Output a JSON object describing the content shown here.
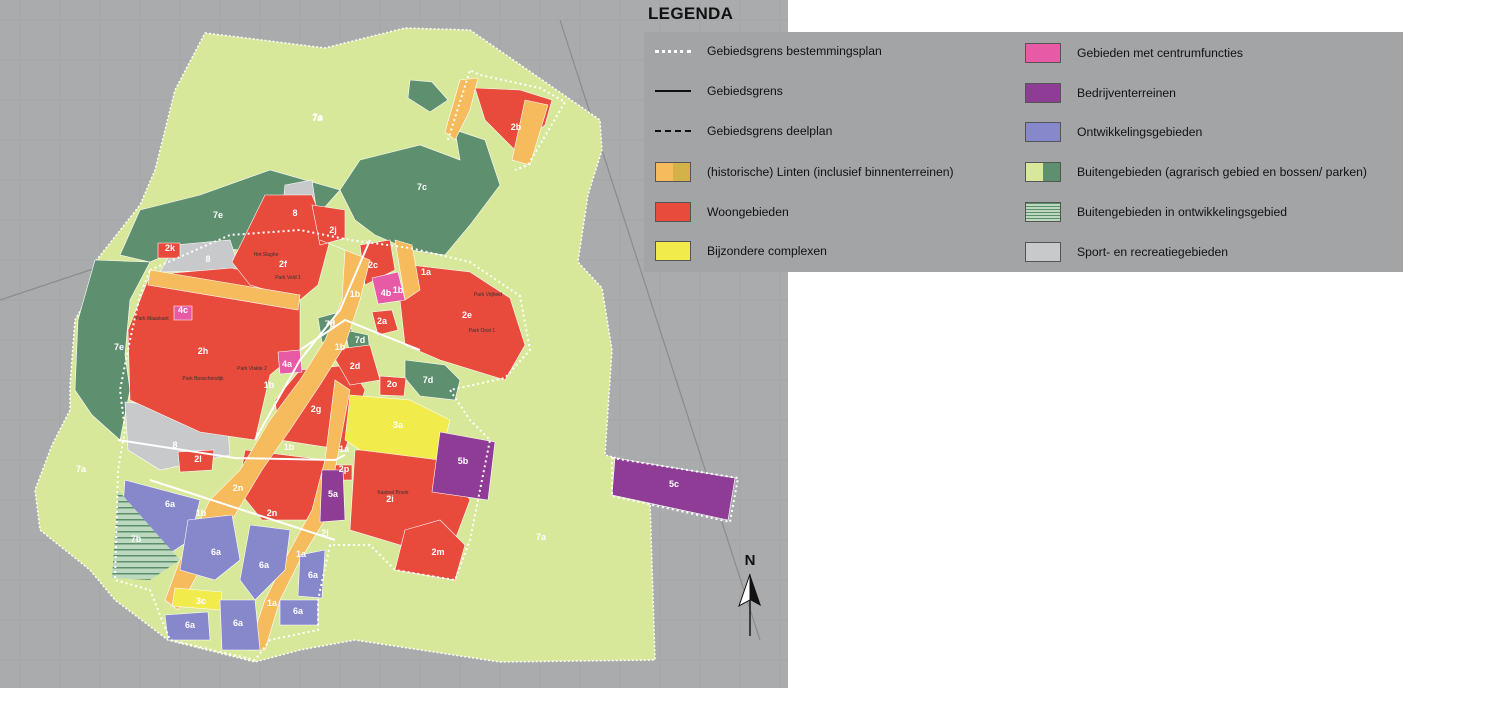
{
  "legend": {
    "title": "LEGENDA",
    "items": [
      {
        "id": "gebiedsgrens-bp",
        "label": "Gebiedsgrens bestemmingsplan",
        "symbol": "dotted-white"
      },
      {
        "id": "gebiedsgrens",
        "label": "Gebiedsgrens",
        "symbol": "solid-black"
      },
      {
        "id": "gebiedsgrens-deelplan",
        "label": "Gebiedsgrens deelplan",
        "symbol": "dashed-black"
      },
      {
        "id": "linten",
        "label": "(historische) Linten (inclusief binnenterreinen)",
        "symbol": "split",
        "colors": [
          "#f6bb5c",
          "#d4b24a"
        ]
      },
      {
        "id": "woongebieden",
        "label": "Woongebieden",
        "symbol": "box",
        "colors": [
          "#e84a3c"
        ]
      },
      {
        "id": "bijzondere",
        "label": "Bijzondere complexen",
        "symbol": "box",
        "colors": [
          "#f2eb4c"
        ]
      },
      {
        "id": "centrum",
        "label": "Gebieden met centrumfuncties",
        "symbol": "box",
        "colors": [
          "#e65aa6"
        ]
      },
      {
        "id": "bedrijven",
        "label": "Bedrijventerreinen",
        "symbol": "box",
        "colors": [
          "#8e3c96"
        ]
      },
      {
        "id": "ontwikkeling",
        "label": "Ontwikkelingsgebieden",
        "symbol": "box",
        "colors": [
          "#8787cc"
        ]
      },
      {
        "id": "buitengebieden",
        "label": "Buitengebieden (agrarisch gebied en bossen/ parken)",
        "symbol": "split",
        "colors": [
          "#d8e89a",
          "#5e9070"
        ]
      },
      {
        "id": "buiten-ontw",
        "label": "Buitengebieden in ontwikkelingsgebied",
        "symbol": "hatch"
      },
      {
        "id": "sport",
        "label": "Sport- en recreatiegebieden",
        "symbol": "box",
        "colors": [
          "#c8c9cb"
        ]
      }
    ]
  },
  "map": {
    "north_label": "N",
    "colors": {
      "outer": "#d8e89a",
      "forest": "#5e9070",
      "housing": "#e84a3c",
      "linten": "#f6bb5c",
      "special": "#f2eb4c",
      "center": "#e65aa6",
      "industry": "#8e3c96",
      "development": "#8787cc",
      "sport": "#c8c9cb"
    },
    "zone_labels": [
      "7a",
      "7a",
      "7a",
      "7a",
      "7c",
      "7e",
      "7e",
      "7d",
      "7d",
      "7d",
      "8",
      "8",
      "8",
      "2b",
      "1b",
      "1a",
      "2k",
      "2j",
      "2f",
      "2c",
      "1a",
      "1b",
      "4b",
      "4c",
      "2h",
      "2a",
      "2e",
      "2d",
      "2o",
      "2g",
      "3a",
      "5b",
      "5c",
      "2l",
      "2n",
      "2n",
      "2p",
      "5a",
      "2i",
      "2i",
      "2m",
      "6a",
      "6a",
      "6a",
      "6a",
      "6a",
      "6a",
      "6a",
      "1b",
      "1a",
      "1a",
      "7b",
      "3c",
      "4a",
      "1b",
      "1b",
      "1b"
    ],
    "place_labels": [
      "Het Slaghe",
      "Park Veld 1",
      "Park Vlakte 2",
      "Park Maaskant",
      "Park Bosschendijk",
      "Park Vrijheid",
      "Kasteel Broek",
      "Park Oost 1"
    ]
  }
}
